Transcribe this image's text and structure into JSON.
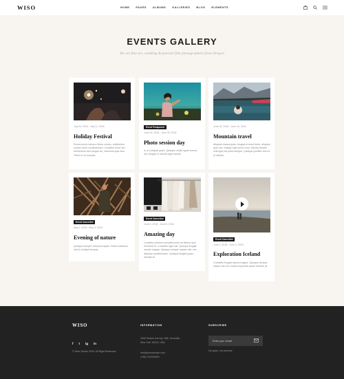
{
  "header": {
    "logo": "WISO",
    "nav": [
      "HOME",
      "PAGES",
      "ALBUMS",
      "GALLERIES",
      "BLOG",
      "ELEMENTS"
    ],
    "icons": [
      "bag-icon",
      "search-icon",
      "menu-icon"
    ]
  },
  "page": {
    "title": "EVENTS GALLERY",
    "subtitle": "We are fine-art, wedding & portrait film photographers from Oregon"
  },
  "events": [
    {
      "date": "July 20, 2018 - July 21, 2018",
      "badge": "",
      "title": "Holiday Festival",
      "desc": "Donec porta metus a libero cursus, vestibulum cursus tortor condimentum. Curabitur tortor leo, elementum sed congue ac, maximus quis eros. There is no excepts.",
      "image": "festival-photo"
    },
    {
      "date": "June 26, 2018 - June 30, 2018",
      "badge": "Event Postponed",
      "title": "Photo session day",
      "desc": "In ut volutpat quam. Quisque mollis ligula viverra nec feugiat ut, lacinia eget mauris.",
      "image": "woman-photo"
    },
    {
      "date": "June 15, 2018 - June 16, 2018",
      "badge": "",
      "title": "Mountain travel",
      "desc": "Aliquam massa justo, feugiat et amet tortor, aliquam quis non. Integer eget lorem eros. Mauris semper velit eget est porta semper. Quisque porttitor sed mi id ultrices.",
      "image": "lake-photo"
    },
    {
      "date": "May 1, 2018 - May 3, 2018",
      "badge": "Event Cancelled",
      "title": "Evening of nature",
      "desc": "Quisque semper euismod sapien. Etiam maximus nisl id volutpat tempus.",
      "image": "nature-photo"
    },
    {
      "date": "June 6, 2018 - June 6, 2018",
      "badge": "Event Cancelled",
      "title": "Amazing day",
      "desc": "Curabitur pretium convallis lorem at dictum arcu hendrerit et. Curabitur eget nisi. Quisque feugiat mauris magna. Quisque semper sapien nisi, nec dapibus condimentum. Quisque feugiat quam lobortis at.",
      "image": "clothes-photo"
    },
    {
      "date": "June 3, 2018 - June 4, 2018",
      "badge": "Event Cancelled",
      "title": "Exploration Iceland",
      "desc": "Curabitur feugiat mauris magna. Quisque semper sapien nisi nec cursus imperdiet quam lobortis at.",
      "image": "iceland-video"
    }
  ],
  "footer": {
    "logo": "WISO",
    "copyright": "© Wiso Studio 2018. All Right Reserved.",
    "info_heading": "INFORMATION",
    "address_line1": "2005 Stokes Isle Apt. 896, Venaville,",
    "address_line2": "New York 10010, USA",
    "email": "info@yourdomain.com",
    "phone": "(+68) 120034509",
    "subscribe_heading": "SUBSCRIBE",
    "email_placeholder": "Enter your email",
    "subscribe_note": "No spam, we promise",
    "social": [
      "f",
      "t",
      "ig",
      "in"
    ]
  }
}
